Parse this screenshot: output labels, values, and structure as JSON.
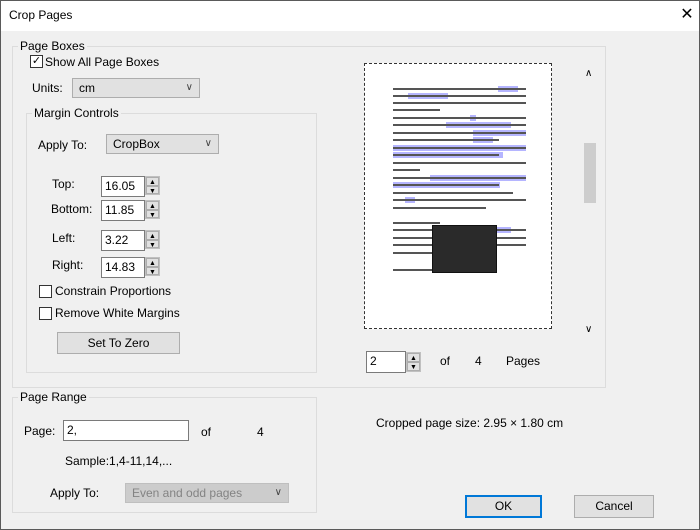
{
  "window": {
    "title": "Crop Pages",
    "close_icon": "close-icon"
  },
  "page_boxes": {
    "label": "Page Boxes",
    "show_all": {
      "label": "Show All Page Boxes",
      "checked": true
    },
    "units": {
      "label": "Units:",
      "value": "cm"
    },
    "margin_controls": {
      "label": "Margin Controls",
      "apply_to": {
        "label": "Apply To:",
        "value": "CropBox"
      },
      "top": {
        "label": "Top:",
        "value": "16.05"
      },
      "bottom": {
        "label": "Bottom:",
        "value": "11.85"
      },
      "left": {
        "label": "Left:",
        "value": "3.22"
      },
      "right": {
        "label": "Right:",
        "value": "14.83"
      },
      "constrain": {
        "label": "Constrain Proportions",
        "checked": false
      },
      "remove_white": {
        "label": "Remove White Margins",
        "checked": false
      },
      "set_zero": "Set To Zero"
    },
    "preview": {
      "page": "2",
      "of": "of",
      "total": "4",
      "pages": "Pages"
    }
  },
  "page_range": {
    "label": "Page Range",
    "page_label": "Page:",
    "page_value": "2,",
    "of": "of",
    "total": "4",
    "sample": "Sample:1,4-11,14,...",
    "apply_to": {
      "label": "Apply To:",
      "value": "Even and odd pages",
      "disabled": true
    }
  },
  "cropped_size": "Cropped page size:  2.95 × 1.80  cm",
  "buttons": {
    "ok": "OK",
    "cancel": "Cancel"
  },
  "colors": {
    "accent": "#0078d7",
    "highlight": "#b5b5ff"
  }
}
